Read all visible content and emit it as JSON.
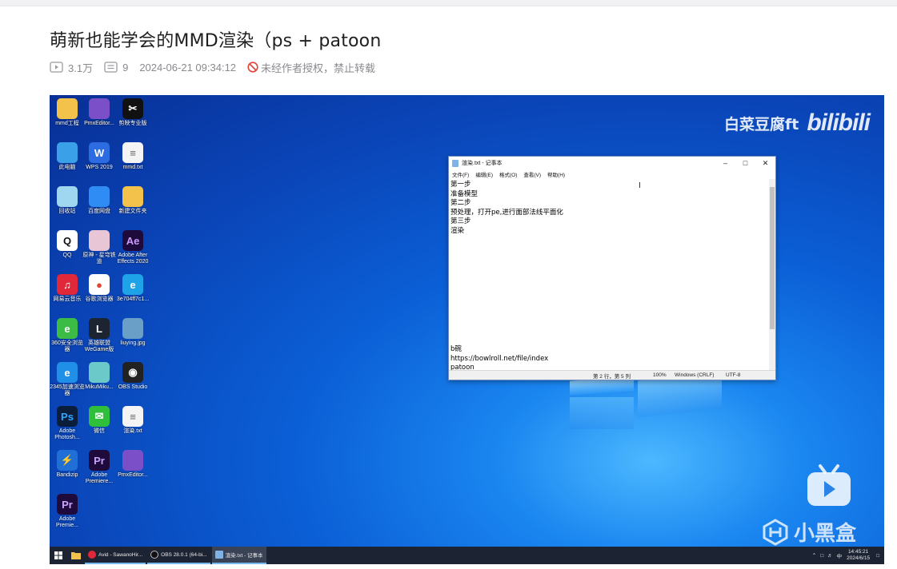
{
  "article": {
    "title": "萌新也能学会的MMD渲染（ps + patoon",
    "views": "3.1万",
    "comments": "9",
    "datetime": "2024-06-21 09:34:12",
    "copyright_notice": "未经作者授权，禁止转载"
  },
  "video": {
    "watermark_name": "白菜豆腐ft",
    "watermark_logo": "bilibili",
    "overlay_brand": "小黑盒"
  },
  "desktop_icons": [
    {
      "label": "mmd工程",
      "icon": "folder-icon",
      "color": "#f2c24a"
    },
    {
      "label": "PmxEditor...",
      "icon": "pmx-icon",
      "color": "#7a4fc7"
    },
    {
      "label": "剪映专业版",
      "icon": "capcut-icon",
      "color": "#111111"
    },
    {
      "label": "此电脑",
      "icon": "computer-icon",
      "color": "#3aa0e8"
    },
    {
      "label": "WPS 2019",
      "icon": "wps-icon",
      "color": "#2c6be0"
    },
    {
      "label": "mmd.txt",
      "icon": "text-file-icon",
      "color": "#f4f4f4"
    },
    {
      "label": "回收站",
      "icon": "recycle-bin-icon",
      "color": "#9fd6f0"
    },
    {
      "label": "百度网盘",
      "icon": "baidu-netdisk-icon",
      "color": "#2f8cf5"
    },
    {
      "label": "新建文件夹",
      "icon": "folder-icon",
      "color": "#f2c24a"
    },
    {
      "label": "QQ",
      "icon": "qq-icon",
      "color": "#ffffff"
    },
    {
      "label": "原神 - 星穹铁道",
      "icon": "game-icon",
      "color": "#e9c6d6"
    },
    {
      "label": "Adobe After Effects 2020",
      "icon": "after-effects-icon",
      "color": "#1f0a3c"
    },
    {
      "label": "网易云音乐",
      "icon": "netease-music-icon",
      "color": "#e0283a"
    },
    {
      "label": "谷歌浏览器",
      "icon": "chrome-icon",
      "color": "#ffffff"
    },
    {
      "label": "3e704ff7c1...",
      "icon": "ie-icon",
      "color": "#1fa3e8"
    },
    {
      "label": "360安全浏览器",
      "icon": "360-browser-icon",
      "color": "#3cbc45"
    },
    {
      "label": "英雄联盟WeGame版",
      "icon": "league-icon",
      "color": "#1b2430"
    },
    {
      "label": "liuying.jpg",
      "icon": "image-file-icon",
      "color": "#6aa0c8"
    },
    {
      "label": "2345加速浏览器",
      "icon": "ie-icon",
      "color": "#1f8fe8"
    },
    {
      "label": "MikuMiku...",
      "icon": "miku-icon",
      "color": "#6cc9c9"
    },
    {
      "label": "OBS Studio",
      "icon": "obs-icon",
      "color": "#222222"
    },
    {
      "label": "Adobe Photosh...",
      "icon": "photoshop-icon",
      "color": "#0a1e3c"
    },
    {
      "label": "微信",
      "icon": "wechat-icon",
      "color": "#2fbf3a"
    },
    {
      "label": "渲染.txt",
      "icon": "text-file-icon",
      "color": "#f4f4f4"
    },
    {
      "label": "Bandizip",
      "icon": "bandizip-icon",
      "color": "#1f6fd6"
    },
    {
      "label": "Adobe Premiere...",
      "icon": "premiere-icon",
      "color": "#1f0a3c"
    },
    {
      "label": "PmxEditor...",
      "icon": "pmx-icon",
      "color": "#7a4fc7"
    },
    {
      "label": "Adobe Premie...",
      "icon": "premiere-icon",
      "color": "#1f0a3c"
    }
  ],
  "notepad": {
    "title": "渲染.txt - 记事本",
    "menu": [
      "文件(F)",
      "编辑(E)",
      "格式(O)",
      "查看(V)",
      "帮助(H)"
    ],
    "lines_top": [
      "第一步",
      "准备模型",
      "第二步",
      "预处理，打开pe,进行面部法线平面化",
      "第三步",
      "渲染"
    ],
    "lines_bottom": [
      "b碗",
      "https://bowlroll.net/file/index",
      "patoon"
    ],
    "status_pos": "第 2 行，第 5 列",
    "status_zoom": "100%",
    "status_eol": "Windows (CRLF)",
    "status_enc": "UTF-8"
  },
  "taskbar": {
    "items": [
      {
        "label": "Avid - SawanoHir...",
        "color": "#e0283a"
      },
      {
        "label": "OBS 28.0.1 (64-bi...",
        "color": "#222222"
      },
      {
        "label": "渲染.txt - 记事本",
        "color": "#7fb3e8"
      }
    ],
    "ime": "中",
    "time": "14:45:21",
    "date": "2024/6/15"
  }
}
